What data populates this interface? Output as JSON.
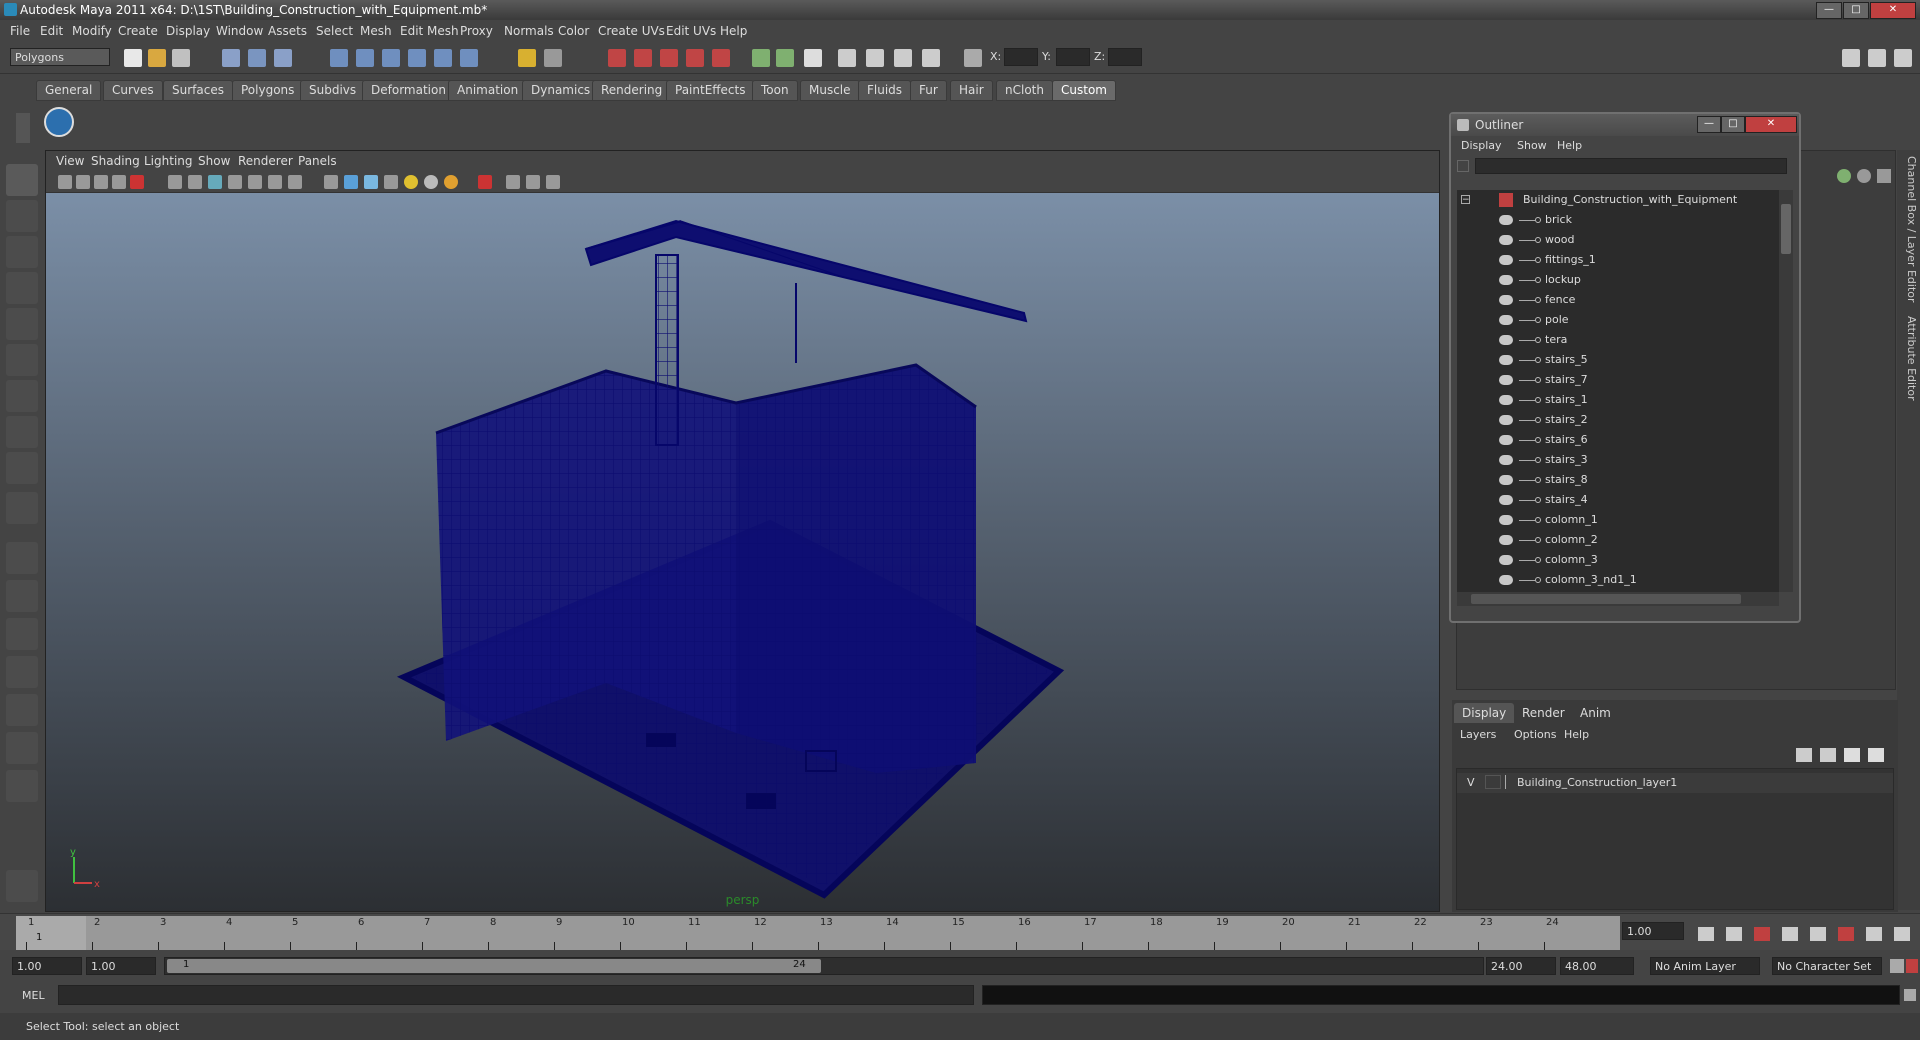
{
  "window": {
    "title": "Autodesk Maya 2011 x64: D:\\1ST\\Building_Construction_with_Equipment.mb*",
    "minimize": "—",
    "maximize": "□",
    "close": "✕"
  },
  "menubar": [
    "File",
    "Edit",
    "Modify",
    "Create",
    "Display",
    "Window",
    "Assets",
    "Select",
    "Mesh",
    "Edit Mesh",
    "Proxy",
    "Normals",
    "Color",
    "Create UVs",
    "Edit UVs",
    "Help"
  ],
  "toolbar": {
    "mode_select": "Polygons",
    "x_label": "X:",
    "y_label": "Y:",
    "z_label": "Z:"
  },
  "shelf_tabs": [
    "General",
    "Curves",
    "Surfaces",
    "Polygons",
    "Subdivs",
    "Deformation",
    "Animation",
    "Dynamics",
    "Rendering",
    "PaintEffects",
    "Toon",
    "Muscle",
    "Fluids",
    "Fur",
    "Hair",
    "nCloth",
    "Custom"
  ],
  "shelf_active": "Custom",
  "viewport": {
    "menu": [
      "View",
      "Shading",
      "Lighting",
      "Show",
      "Renderer",
      "Panels"
    ],
    "camera_label": "persp",
    "axis_y": "y",
    "axis_x": "x"
  },
  "outliner": {
    "title": "Outliner",
    "menu": [
      "Display",
      "Show",
      "Help"
    ],
    "root": "Building_Construction_with_Equipment",
    "items": [
      "brick",
      "wood",
      "fittings_1",
      "lockup",
      "fence",
      "pole",
      "tera",
      "stairs_5",
      "stairs_7",
      "stairs_1",
      "stairs_2",
      "stairs_6",
      "stairs_3",
      "stairs_8",
      "stairs_4",
      "colomn_1",
      "colomn_2",
      "colomn_3",
      "colomn_3_nd1_1"
    ]
  },
  "layers": {
    "tabs": [
      "Display",
      "Render",
      "Anim"
    ],
    "active_tab": "Display",
    "menu": [
      "Layers",
      "Options",
      "Help"
    ],
    "layer_visibility": "V",
    "layer_name": "Building_Construction_layer1"
  },
  "side_tabs": [
    "Channel Box / Layer Editor",
    "Attribute Editor"
  ],
  "timeline": {
    "ticks": [
      "1",
      "2",
      "3",
      "4",
      "5",
      "6",
      "7",
      "8",
      "9",
      "10",
      "11",
      "12",
      "13",
      "14",
      "15",
      "16",
      "17",
      "18",
      "19",
      "20",
      "21",
      "22",
      "23",
      "24"
    ],
    "current_frame": "1",
    "current_time_field": "1.00"
  },
  "range": {
    "start": "1.00",
    "start2": "1.00",
    "slider_start": "1",
    "slider_end": "24",
    "end": "24.00",
    "end2": "48.00",
    "anim_layer": "No Anim Layer",
    "char_set": "No Character Set"
  },
  "command": {
    "label": "MEL"
  },
  "help_line": "Select Tool: select an object"
}
